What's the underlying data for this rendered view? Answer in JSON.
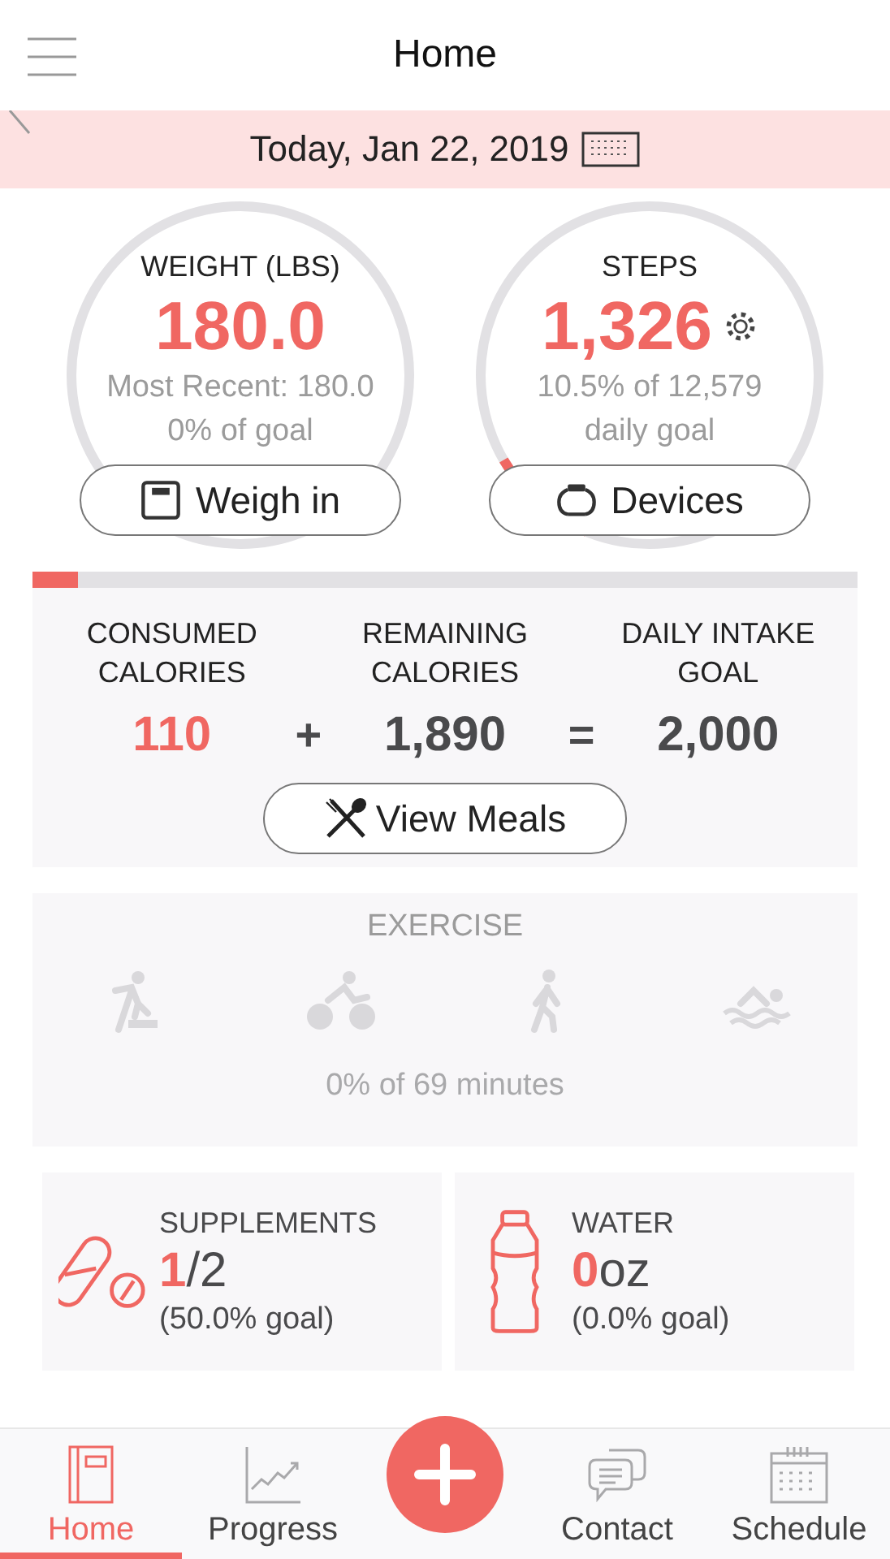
{
  "header": {
    "title": "Home"
  },
  "date_bar": {
    "date": "Today, Jan 22, 2019"
  },
  "rings": [
    {
      "kind": "weight",
      "title": "WEIGHT (LBS)",
      "value": "180.0",
      "lines": [
        "Most Recent: 180.0",
        "0% of goal"
      ],
      "settings": false,
      "button": {
        "label": "Weigh in",
        "kind": "scale"
      }
    },
    {
      "kind": "steps",
      "title": "STEPS",
      "value": "1,326",
      "lines": [
        "10.5% of 12,579",
        "daily goal"
      ],
      "settings": true,
      "button": {
        "label": "Devices",
        "kind": "band"
      }
    }
  ],
  "calories": {
    "level": 0.055,
    "columns": [
      {
        "label": "CONSUMED CALORIES",
        "value": "110",
        "highlight": true
      },
      {
        "label": "REMAINING CALORIES",
        "value": "1,890",
        "highlight": false
      },
      {
        "label": "DAILY INTAKE GOAL",
        "value": "2,000",
        "highlight": false
      }
    ],
    "operators": [
      "+",
      "="
    ],
    "button": "View Meals"
  },
  "exercise": {
    "title": "EXERCISE",
    "activities": [
      {
        "kind": "step"
      },
      {
        "kind": "cycle"
      },
      {
        "kind": "walk"
      },
      {
        "kind": "swim"
      }
    ],
    "caption": "0% of 69 minutes"
  },
  "trackers": [
    {
      "kind": "pill",
      "title": "SUPPLEMENTS",
      "value": "1",
      "unit": "/2",
      "goal": "(50.0% goal)"
    },
    {
      "kind": "bottle",
      "title": "WATER",
      "value": "0",
      "unit": "oz",
      "goal": "(0.0% goal)"
    }
  ],
  "nav": {
    "items": [
      {
        "label": "Home",
        "kind": "book",
        "selected": true
      },
      {
        "label": "Progress",
        "kind": "chart",
        "selected": false
      },
      {
        "kind": "add"
      },
      {
        "label": "Contact",
        "kind": "chat",
        "selected": false
      },
      {
        "label": "Schedule",
        "kind": "calendar",
        "selected": false
      }
    ]
  }
}
